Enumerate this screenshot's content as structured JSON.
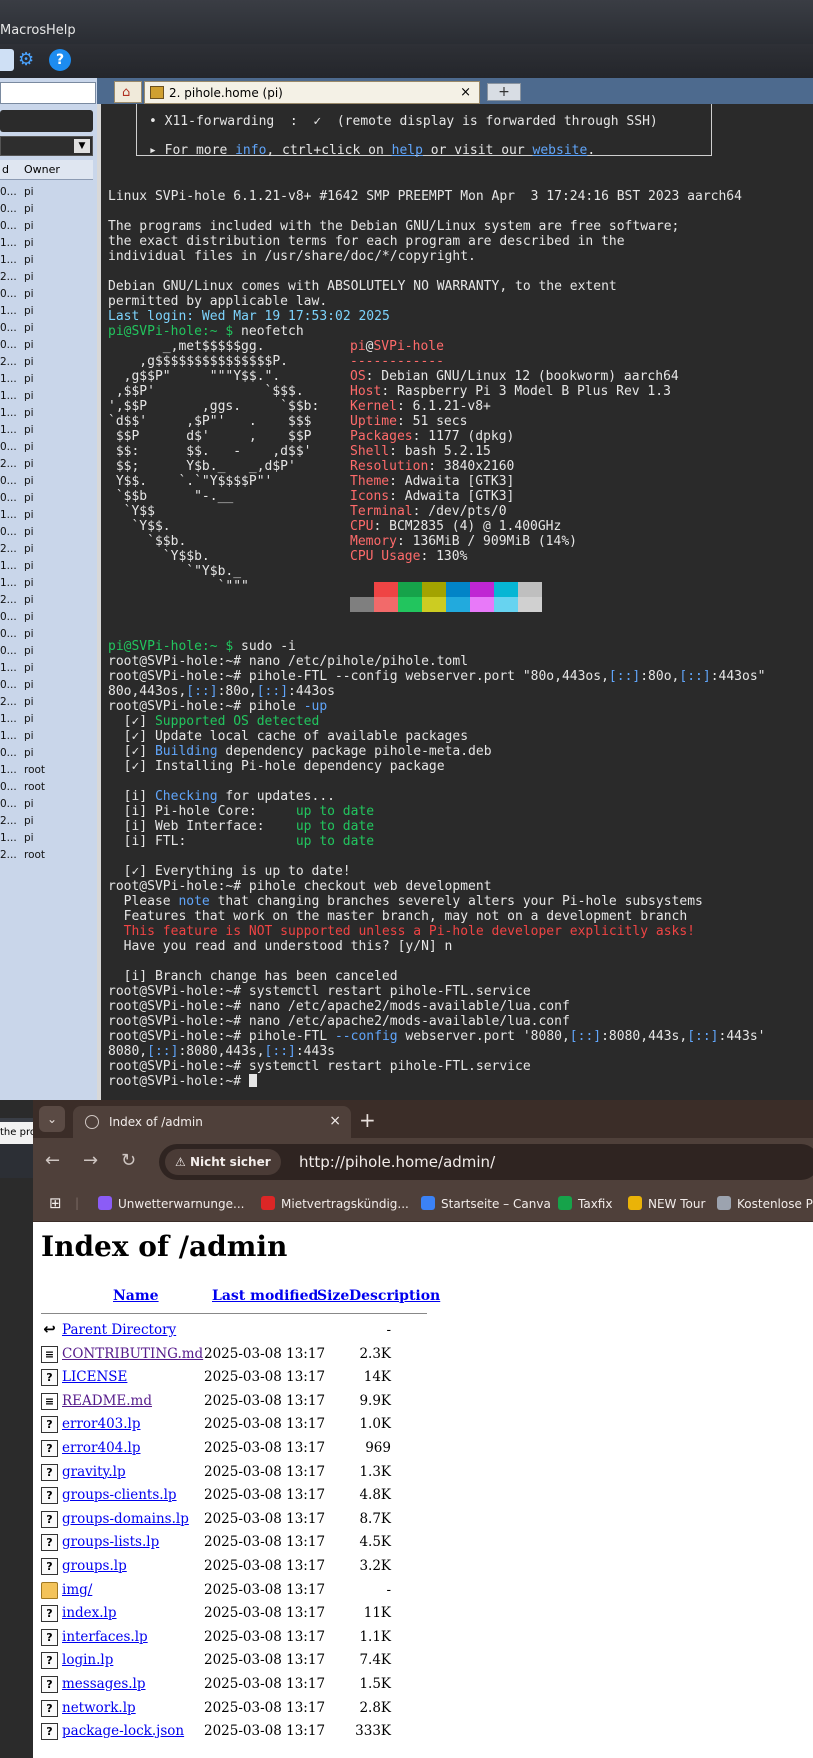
{
  "menubar": {
    "items": [
      "Macros",
      "Help"
    ]
  },
  "left_panel": {
    "header": {
      "col1": "d",
      "col2": "Owner"
    },
    "rows": [
      {
        "a": "0...",
        "b": "pi"
      },
      {
        "a": "0...",
        "b": "pi"
      },
      {
        "a": "0...",
        "b": "pi"
      },
      {
        "a": "1...",
        "b": "pi"
      },
      {
        "a": "1...",
        "b": "pi"
      },
      {
        "a": "2...",
        "b": "pi"
      },
      {
        "a": "0...",
        "b": "pi"
      },
      {
        "a": "1...",
        "b": "pi"
      },
      {
        "a": "0...",
        "b": "pi"
      },
      {
        "a": "0...",
        "b": "pi"
      },
      {
        "a": "2...",
        "b": "pi"
      },
      {
        "a": "1...",
        "b": "pi"
      },
      {
        "a": "1...",
        "b": "pi"
      },
      {
        "a": "1...",
        "b": "pi"
      },
      {
        "a": "1...",
        "b": "pi"
      },
      {
        "a": "0...",
        "b": "pi"
      },
      {
        "a": "2...",
        "b": "pi"
      },
      {
        "a": "0...",
        "b": "pi"
      },
      {
        "a": "0...",
        "b": "pi"
      },
      {
        "a": "1...",
        "b": "pi"
      },
      {
        "a": "0...",
        "b": "pi"
      },
      {
        "a": "2...",
        "b": "pi"
      },
      {
        "a": "1...",
        "b": "pi"
      },
      {
        "a": "1...",
        "b": "pi"
      },
      {
        "a": "2...",
        "b": "pi"
      },
      {
        "a": "0...",
        "b": "pi"
      },
      {
        "a": "0...",
        "b": "pi"
      },
      {
        "a": "0...",
        "b": "pi"
      },
      {
        "a": "1...",
        "b": "pi"
      },
      {
        "a": "0...",
        "b": "pi"
      },
      {
        "a": "2...",
        "b": "pi"
      },
      {
        "a": "1...",
        "b": "pi"
      },
      {
        "a": "1...",
        "b": "pi"
      },
      {
        "a": "0...",
        "b": "pi"
      },
      {
        "a": "1...",
        "b": "root"
      },
      {
        "a": "0...",
        "b": "root"
      },
      {
        "a": "0...",
        "b": "pi"
      },
      {
        "a": "2...",
        "b": "pi"
      },
      {
        "a": "1...",
        "b": "pi"
      },
      {
        "a": "2...",
        "b": "root"
      }
    ],
    "status": "the pro"
  },
  "terminal_tab": {
    "title": "2. pihole.home (pi)",
    "close": "×",
    "new": "+"
  },
  "terminal": {
    "box1": "• X11-forwarding  :  ✓  (remote display is forwarded through SSH)",
    "box2a": "▸ For more ",
    "box2_info": "info",
    "box2b": ", ctrl+click on ",
    "box2_help": "help",
    "box2c": " or visit our ",
    "box2_web": "website",
    "box2d": ".",
    "uname": "Linux SVPi-hole 6.1.21-v8+ #1642 SMP PREEMPT Mon Apr  3 17:24:16 BST 2023 aarch64",
    "free1": "The programs included with the Debian GNU/Linux system are free software;",
    "free2": "the exact distribution terms for each program are described in the",
    "free3": "individual files in /usr/share/doc/*/copyright.",
    "warr1": "Debian GNU/Linux comes with ABSOLUTELY NO WARRANTY, to the extent",
    "warr2": "permitted by applicable law.",
    "lastlogin_lbl": "Last login",
    "lastlogin": ": Wed Mar 19 17:53:02 2025",
    "prompt_pi": "pi@SVPi-hole:~ $",
    "cmd_neofetch": " neofetch",
    "ascii": [
      "       _,met$$$$$gg.",
      "    ,g$$$$$$$$$$$$$$$P.",
      "  ,g$$P\"     \"\"\"Y$$.\".",
      " ,$$P'              `$$$.",
      "',$$P       ,ggs.     `$$b:",
      "`d$$'     ,$P\"'   .    $$$",
      " $$P      d$'     ,    $$P",
      " $$:      $$.   -    ,d$$'",
      " $$;      Y$b._   _,d$P'",
      " Y$$.    `.`\"Y$$$$P\"'",
      " `$$b      \"-.__",
      "  `Y$$",
      "   `Y$$.",
      "     `$$b.",
      "       `Y$$b.",
      "          `\"Y$b._",
      "              `\"\"\""
    ],
    "nf_user": "pi",
    "nf_at": "@",
    "nf_host": "SVPi-hole",
    "nf_sep": "------------",
    "nf": [
      {
        "k": "OS",
        "v": ": Debian GNU/Linux 12 (bookworm) aarch64"
      },
      {
        "k": "Host",
        "v": ": Raspberry Pi 3 Model B Plus Rev 1.3"
      },
      {
        "k": "Kernel",
        "v": ": 6.1.21-v8+"
      },
      {
        "k": "Uptime",
        "v": ": 51 secs"
      },
      {
        "k": "Packages",
        "v": ": 1177 (dpkg)"
      },
      {
        "k": "Shell",
        "v": ": bash 5.2.15"
      },
      {
        "k": "Resolution",
        "v": ": 3840x2160"
      },
      {
        "k": "Theme",
        "v": ": Adwaita [GTK3]"
      },
      {
        "k": "Icons",
        "v": ": Adwaita [GTK3]"
      },
      {
        "k": "Terminal",
        "v": ": /dev/pts/0"
      },
      {
        "k": "CPU",
        "v": ": BCM2835 (4) @ 1.400GHz"
      },
      {
        "k": "Memory",
        "v": ": 136MiB / 909MiB (14%)"
      },
      {
        "k": "CPU Usage",
        "v": ": 130%"
      }
    ],
    "palette_colors": [
      "#7f7f7f",
      "#f26a6a",
      "#22c55e",
      "#cccc22",
      "#22aadd",
      "#e879f9",
      "#67d3f0",
      "#d0d0d0"
    ],
    "palette_top": [
      "#2a2a2a",
      "#ef4444",
      "#16a34a",
      "#a3a300",
      "#0284c7",
      "#c026d3",
      "#06b6d4",
      "#bfbfbf"
    ],
    "cmd_sudo": " sudo -i",
    "root_prompt": "root@SVPi-hole:~#",
    "c1": " nano /etc/pihole/pihole.toml",
    "c2a": " pihole-FTL --config webserver.port \"80o,443os,",
    "c2b": "[::]",
    "c2c": ":80o,",
    "c2d": "[::]",
    "c2e": ":443os\"",
    "o2a": "80o,443os,",
    "o2b": "[::]",
    "o2c": ":80o,",
    "o2d": "[::]",
    "o2e": ":443os",
    "c3a": " pihole ",
    "c3b": "-up",
    "u1": "  [✓] ",
    "u1t": "Supported OS detected",
    "u2": "  [✓] Update local cache of available packages",
    "u3": "  [✓] ",
    "u3t": "Building",
    "u3r": " dependency package pihole-meta.deb",
    "u4": "  [✓] Installing Pi-hole dependency package",
    "i1": "  [i] ",
    "i1t": "Checking",
    "i1r": " for updates...",
    "i2": "  [i] Pi-hole Core:     ",
    "i2t": "up to date",
    "i3": "  [i] Web Interface:    ",
    "i3t": "up to date",
    "i4": "  [i] FTL:              ",
    "i4t": "up to date",
    "done": "  [✓] Everything is up to date!",
    "c4": " pihole checkout web development",
    "w1a": "  Please ",
    "w1b": "note",
    "w1c": " that changing branches severely alters your Pi-hole subsystems",
    "w2": "  Features that work on the master branch, may not on a development branch",
    "w3": "  This feature is NOT supported unless a Pi-hole developer explicitly asks!",
    "w4": "  Have you read and understood this? [y/N] n",
    "cancel": "  [i] Branch change has been canceled",
    "c5": " systemctl restart pihole-FTL.service",
    "c6": " nano /etc/apache2/mods-available/lua.conf",
    "c7": " nano /etc/apache2/mods-available/lua.conf",
    "c8a": " pihole-FTL ",
    "c8b": "--config",
    "c8c": " webserver.port '8080,",
    "c8d": "[::]",
    "c8e": ":8080,443s,",
    "c8f": "[::]",
    "c8g": ":443s'",
    "o8a": "8080,",
    "o8b": "[::]",
    "o8c": ":8080,443s,",
    "o8d": "[::]",
    "o8e": ":443s",
    "c9": " systemctl restart pihole-FTL.service"
  },
  "browser": {
    "tab_title": "Index of /admin",
    "tab_close": "×",
    "new_tab": "+",
    "security": "Nicht sicher",
    "url": "http://pihole.home/admin/",
    "bookmarks": [
      "Unwetterwarnunge...",
      "Mietvertragskündig...",
      "Startseite – Canva",
      "Taxfix",
      "NEW Tour",
      "Kostenlose P"
    ],
    "bookmark_colors": [
      "#8b5cf6",
      "#dc2626",
      "#3b82f6",
      "#16a34a",
      "#eab308",
      "#9ca3af"
    ]
  },
  "listing": {
    "title": "Index of /admin",
    "headers": {
      "name": "Name",
      "modified": "Last modified",
      "size": "Size",
      "desc": "Description"
    },
    "rows": [
      {
        "icon": "back",
        "name": "Parent Directory",
        "date": "",
        "size": "-",
        "visited": false
      },
      {
        "icon": "doc",
        "name": "CONTRIBUTING.md",
        "date": "2025-03-08 13:17",
        "size": "2.3K",
        "visited": true
      },
      {
        "icon": "?",
        "name": "LICENSE",
        "date": "2025-03-08 13:17",
        "size": "14K",
        "visited": false
      },
      {
        "icon": "doc",
        "name": "README.md",
        "date": "2025-03-08 13:17",
        "size": "9.9K",
        "visited": true
      },
      {
        "icon": "?",
        "name": "error403.lp",
        "date": "2025-03-08 13:17",
        "size": "1.0K",
        "visited": false
      },
      {
        "icon": "?",
        "name": "error404.lp",
        "date": "2025-03-08 13:17",
        "size": "969",
        "visited": false
      },
      {
        "icon": "?",
        "name": "gravity.lp",
        "date": "2025-03-08 13:17",
        "size": "1.3K",
        "visited": false
      },
      {
        "icon": "?",
        "name": "groups-clients.lp",
        "date": "2025-03-08 13:17",
        "size": "4.8K",
        "visited": false
      },
      {
        "icon": "?",
        "name": "groups-domains.lp",
        "date": "2025-03-08 13:17",
        "size": "8.7K",
        "visited": false
      },
      {
        "icon": "?",
        "name": "groups-lists.lp",
        "date": "2025-03-08 13:17",
        "size": "4.5K",
        "visited": false
      },
      {
        "icon": "?",
        "name": "groups.lp",
        "date": "2025-03-08 13:17",
        "size": "3.2K",
        "visited": false
      },
      {
        "icon": "folder",
        "name": "img/",
        "date": "2025-03-08 13:17",
        "size": "-",
        "visited": false
      },
      {
        "icon": "?",
        "name": "index.lp",
        "date": "2025-03-08 13:17",
        "size": "11K",
        "visited": false
      },
      {
        "icon": "?",
        "name": "interfaces.lp",
        "date": "2025-03-08 13:17",
        "size": "1.1K",
        "visited": false
      },
      {
        "icon": "?",
        "name": "login.lp",
        "date": "2025-03-08 13:17",
        "size": "7.4K",
        "visited": false
      },
      {
        "icon": "?",
        "name": "messages.lp",
        "date": "2025-03-08 13:17",
        "size": "1.5K",
        "visited": false
      },
      {
        "icon": "?",
        "name": "network.lp",
        "date": "2025-03-08 13:17",
        "size": "2.8K",
        "visited": false
      },
      {
        "icon": "?",
        "name": "package-lock.json",
        "date": "2025-03-08 13:17",
        "size": "333K",
        "visited": false
      }
    ]
  }
}
